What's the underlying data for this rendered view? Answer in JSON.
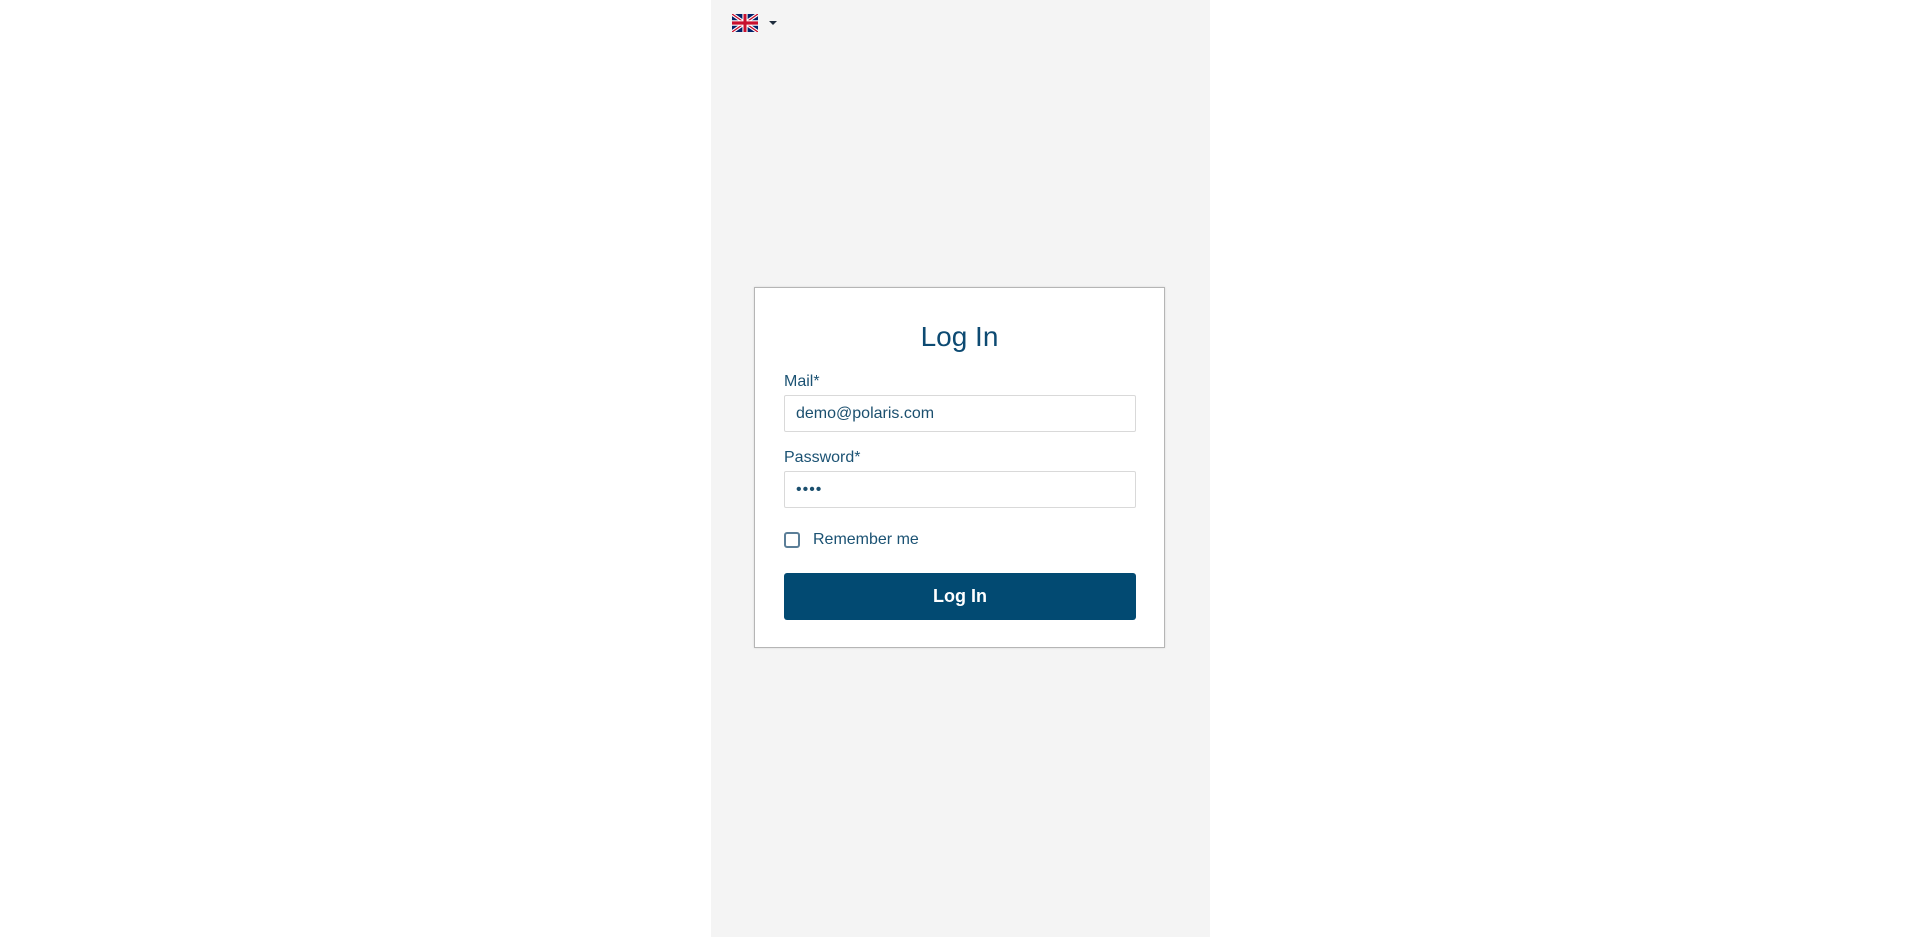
{
  "language": {
    "flag_icon": "uk-flag-icon",
    "dropdown_icon": "caret-down-icon"
  },
  "login": {
    "title": "Log In",
    "mail_label": "Mail*",
    "mail_value": "demo@polaris.com",
    "password_label": "Password*",
    "password_value": "demo",
    "remember_label": "Remember me",
    "remember_checked": false,
    "submit_label": "Log In"
  },
  "colors": {
    "primary": "#024a72",
    "text": "#1b5273",
    "panel_background": "#f4f4f4",
    "card_border": "#b5b5b5"
  }
}
